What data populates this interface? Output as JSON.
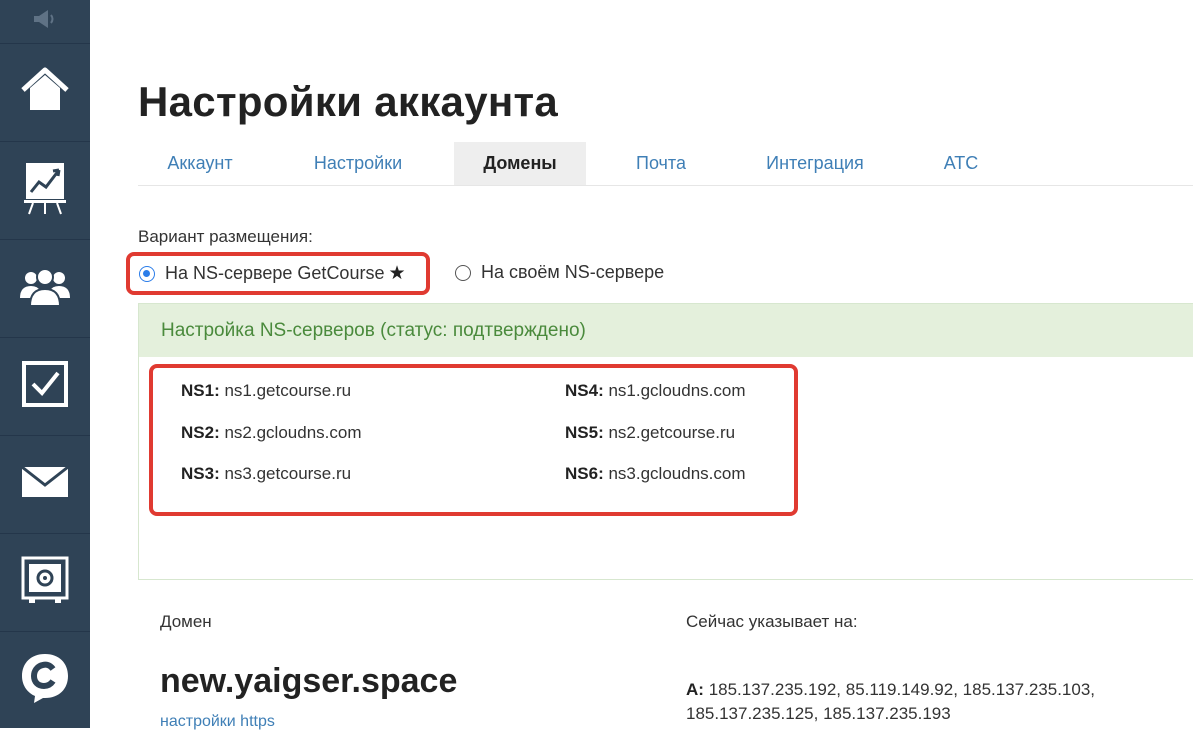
{
  "sidebar": {
    "items": [
      {
        "icon": "megaphone-icon"
      },
      {
        "icon": "home-icon"
      },
      {
        "icon": "chart-board-icon"
      },
      {
        "icon": "users-icon"
      },
      {
        "icon": "checkbox-icon"
      },
      {
        "icon": "mail-icon"
      },
      {
        "icon": "safe-icon"
      },
      {
        "icon": "getcourse-logo-icon"
      }
    ]
  },
  "page": {
    "title": "Настройки аккаунта"
  },
  "tabs": [
    {
      "label": "Аккаунт",
      "active": false
    },
    {
      "label": "Настройки",
      "active": false
    },
    {
      "label": "Домены",
      "active": true
    },
    {
      "label": "Почта",
      "active": false
    },
    {
      "label": "Интеграция",
      "active": false
    },
    {
      "label": "АТС",
      "active": false
    }
  ],
  "placement": {
    "label": "Вариант размещения:",
    "options": [
      {
        "label": "На NS-сервере GetCourse",
        "selected": true,
        "star": "★"
      },
      {
        "label": "На своём NS-сервере",
        "selected": false
      }
    ]
  },
  "ns_panel": {
    "header": "Настройка NS-серверов (статус: подтверждено)",
    "servers": [
      {
        "key": "NS1:",
        "value": "ns1.getcourse.ru"
      },
      {
        "key": "NS2:",
        "value": "ns2.gcloudns.com"
      },
      {
        "key": "NS3:",
        "value": "ns3.getcourse.ru"
      },
      {
        "key": "NS4:",
        "value": "ns1.gcloudns.com"
      },
      {
        "key": "NS5:",
        "value": "ns2.getcourse.ru"
      },
      {
        "key": "NS6:",
        "value": "ns3.gcloudns.com"
      }
    ]
  },
  "domain": {
    "col_label": "Домен",
    "name": "new.yaigser.space",
    "settings_link": "настройки https",
    "points_label": "Сейчас указывает на:",
    "a_key": "A:",
    "a_line1": "185.137.235.192, 85.119.149.92, 185.137.235.103,",
    "a_line2": "185.137.235.125, 185.137.235.193"
  },
  "colors": {
    "sidebar": "#2f4356",
    "link": "#3f7fb6",
    "highlight": "#e03a31",
    "success_bg": "#e4f0dc",
    "success_text": "#4a8a3c"
  }
}
